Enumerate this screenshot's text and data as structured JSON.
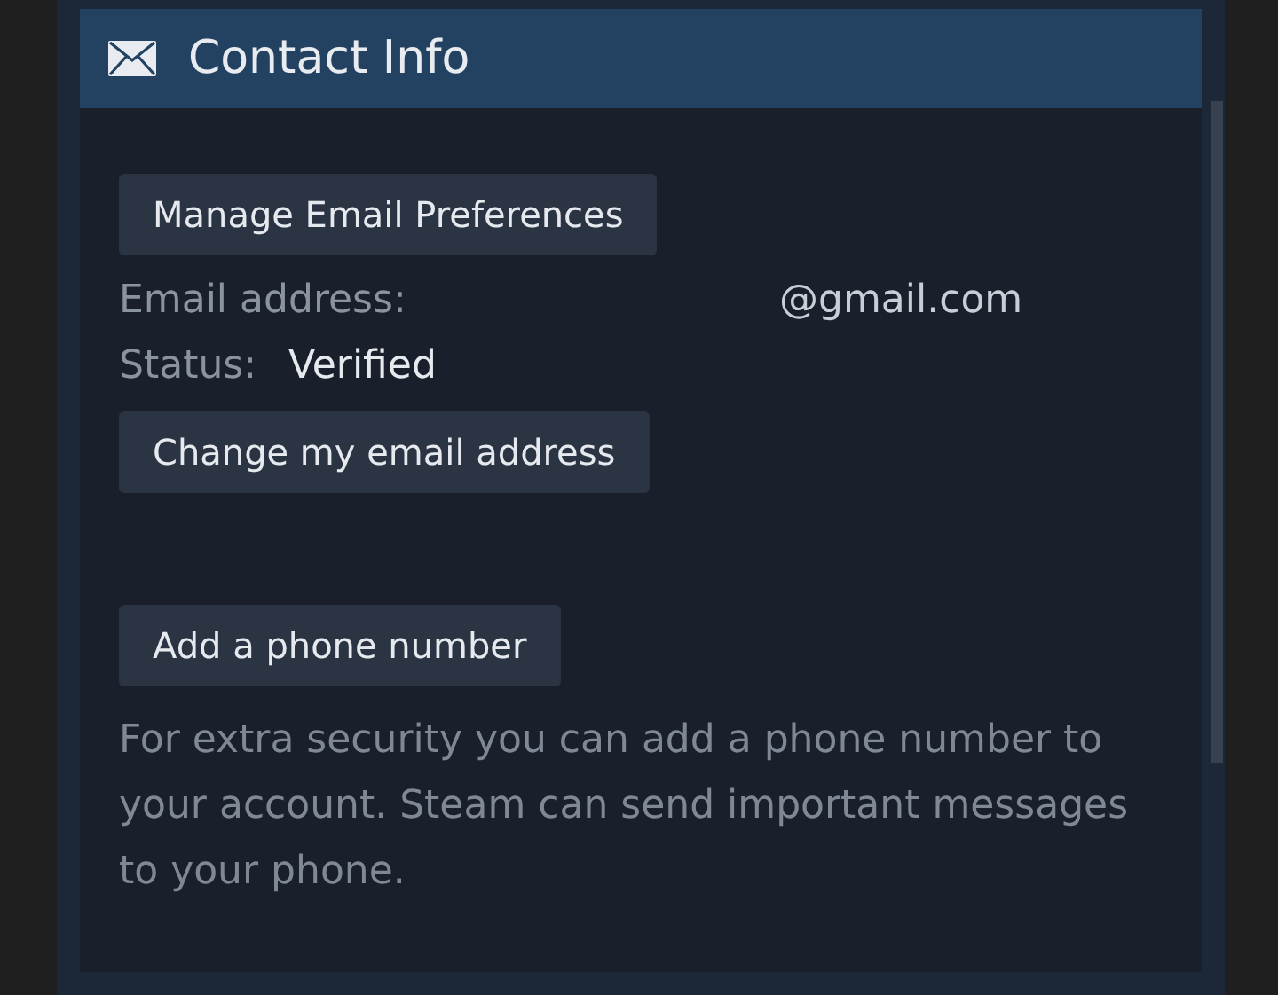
{
  "header": {
    "title": "Contact Info"
  },
  "email_preferences_button": "Manage Email Preferences",
  "email": {
    "label": "Email address:",
    "value": "@gmail.com"
  },
  "status": {
    "label": "Status:",
    "value": "Verified"
  },
  "change_email_button": "Change my email address",
  "add_phone_button": "Add a phone number",
  "phone_note": "For extra security you can add a phone number to your account. Steam can send important messages to your phone."
}
